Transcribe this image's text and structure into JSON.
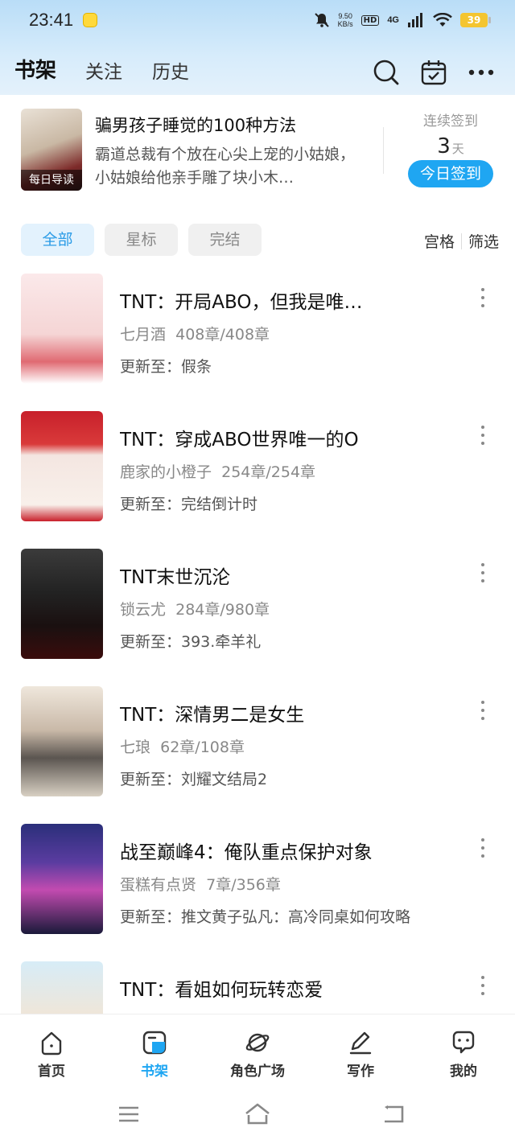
{
  "status": {
    "time": "23:41",
    "net_speed": "9.50",
    "net_unit": "KB/s",
    "hd": "HD",
    "signal": "4G",
    "battery": "39"
  },
  "header": {
    "tabs": [
      {
        "label": "书架",
        "active": true
      },
      {
        "label": "关注",
        "active": false
      },
      {
        "label": "历史",
        "active": false
      }
    ]
  },
  "daily": {
    "tag": "每日导读",
    "title": "骗男孩子睡觉的100种方法",
    "desc": "霸道总裁有个放在心尖上宠的小姑娘，小姑娘给他亲手雕了块小木…",
    "checkin_label": "连续签到",
    "checkin_days": "3",
    "checkin_unit": "天",
    "checkin_button": "今日签到"
  },
  "filters": {
    "chips": [
      "全部",
      "星标",
      "完结"
    ],
    "grid": "宫格",
    "filter": "筛选"
  },
  "books": [
    {
      "title": "TNT：开局ABO，但我是唯…",
      "author": "七月酒",
      "chapters": "408章/408章",
      "update": "更新至：假条"
    },
    {
      "title": "TNT：穿成ABO世界唯一的O",
      "author": "鹿家的小橙子",
      "chapters": "254章/254章",
      "update": "更新至：完结倒计时"
    },
    {
      "title": "TNT末世沉沦",
      "author": "锁云尤",
      "chapters": "284章/980章",
      "update": "更新至：393.牵羊礼"
    },
    {
      "title": "TNT：深情男二是女生",
      "author": "七琅",
      "chapters": "62章/108章",
      "update": "更新至：刘耀文结局2"
    },
    {
      "title": "战至巅峰4：俺队重点保护对象",
      "author": "蛋糕有点贤",
      "chapters": "7章/356章",
      "update": "更新至：推文黄子弘凡：高冷同桌如何攻略"
    },
    {
      "title": "TNT：看姐如何玩转恋爱",
      "author": "",
      "chapters": "",
      "update": ""
    }
  ],
  "tabbar": [
    {
      "label": "首页",
      "icon": "home-icon",
      "active": false
    },
    {
      "label": "书架",
      "icon": "bookshelf-icon",
      "active": true
    },
    {
      "label": "角色广场",
      "icon": "planet-icon",
      "active": false
    },
    {
      "label": "写作",
      "icon": "pen-icon",
      "active": false
    },
    {
      "label": "我的",
      "icon": "chat-bubble-icon",
      "active": false
    }
  ],
  "colors": {
    "accent": "#1fa6f2",
    "header_gradient_top": "#b9ddf7"
  }
}
